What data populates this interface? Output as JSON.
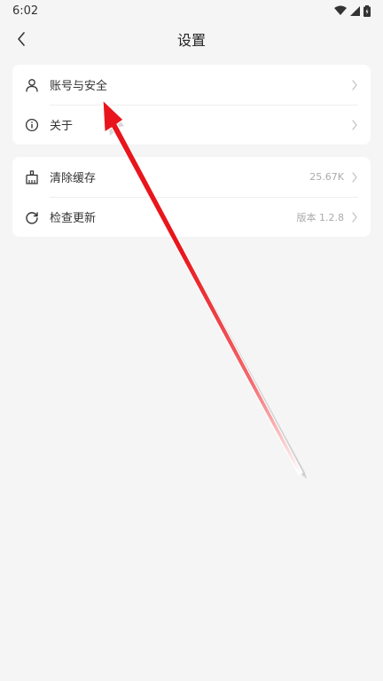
{
  "status_bar": {
    "time": "6:02"
  },
  "header": {
    "title": "设置"
  },
  "groups": [
    {
      "items": [
        {
          "label": "账号与安全",
          "value": ""
        },
        {
          "label": "关于",
          "value": ""
        }
      ]
    },
    {
      "items": [
        {
          "label": "清除缓存",
          "value": "25.67K"
        },
        {
          "label": "检查更新",
          "value": "版本 1.2.8"
        }
      ]
    }
  ],
  "icons": {
    "account": "user-icon",
    "about": "info-icon",
    "cache": "broom-icon",
    "update": "refresh-icon",
    "back": "back-arrow-icon",
    "chevron": "chevron-right-icon"
  },
  "colors": {
    "background": "#f5f5f5",
    "card": "#ffffff",
    "annotation_arrow": "#e8161c"
  }
}
